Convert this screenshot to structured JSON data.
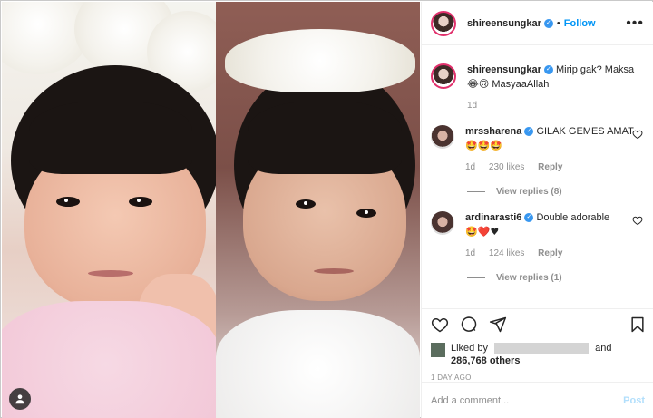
{
  "post": {
    "username": "shireensungkar",
    "follow_label": "Follow",
    "more_label": "•••",
    "caption_text": "Mirip gak? Maksa",
    "caption_emoji": "😂🙃",
    "caption_tail": "MasyaaAllah",
    "caption_age": "1d"
  },
  "comments": [
    {
      "username": "mrssharena",
      "text": "GILAK GEMES AMAT",
      "emoji": "🤩🤩🤩",
      "age": "1d",
      "likes": "230 likes",
      "reply_label": "Reply",
      "view_replies": "View replies (8)"
    },
    {
      "username": "ardinarasti6",
      "text": "Double adorable",
      "emoji": "🤩❤️♥",
      "age": "1d",
      "likes": "124 likes",
      "reply_label": "Reply",
      "view_replies": "View replies (1)"
    }
  ],
  "likes": {
    "prefix": "Liked by",
    "connector": "and",
    "count": "286,768 others"
  },
  "timestamp": "1 DAY AGO",
  "add_comment": {
    "placeholder": "Add a comment...",
    "post_label": "Post"
  },
  "icons": {
    "like": "heart-icon",
    "comment": "comment-icon",
    "share": "paper-plane-icon",
    "save": "bookmark-icon",
    "tagged": "user-tag-icon"
  },
  "colors": {
    "link": "#0095f6",
    "verified": "#3897f0",
    "muted": "#8e8e8e",
    "post_disabled": "#b2dffc"
  }
}
